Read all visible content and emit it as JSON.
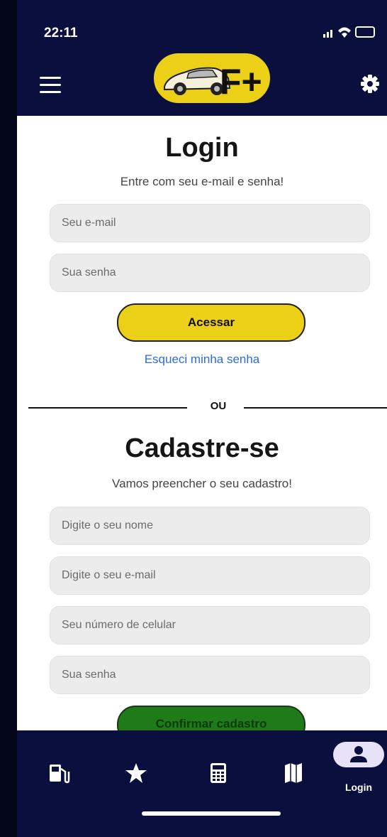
{
  "status": {
    "time": "22:11"
  },
  "header": {
    "logo_text": "F+"
  },
  "login": {
    "title": "Login",
    "subtitle": "Entre com seu e-mail e senha!",
    "email_placeholder": "Seu e-mail",
    "password_placeholder": "Sua senha",
    "submit_label": "Acessar",
    "forgot_label": "Esqueci minha senha"
  },
  "divider": {
    "text": "OU"
  },
  "register": {
    "title": "Cadastre-se",
    "subtitle": "Vamos preencher o seu cadastro!",
    "name_placeholder": "Digite o seu nome",
    "email_placeholder": "Digite o seu e-mail",
    "phone_placeholder": "Seu número de celular",
    "password_placeholder": "Sua senha",
    "submit_label": "Confirmar cadastro"
  },
  "tabs": [
    {
      "icon": "gas-pump-icon"
    },
    {
      "icon": "star-icon"
    },
    {
      "icon": "calculator-icon"
    },
    {
      "icon": "map-icon"
    },
    {
      "icon": "user-icon",
      "label": "Login",
      "active": true
    }
  ],
  "colors": {
    "navy": "#0b0f3d",
    "yellow": "#ecd018",
    "green": "#1f7a1a",
    "link": "#2f6bd4"
  }
}
